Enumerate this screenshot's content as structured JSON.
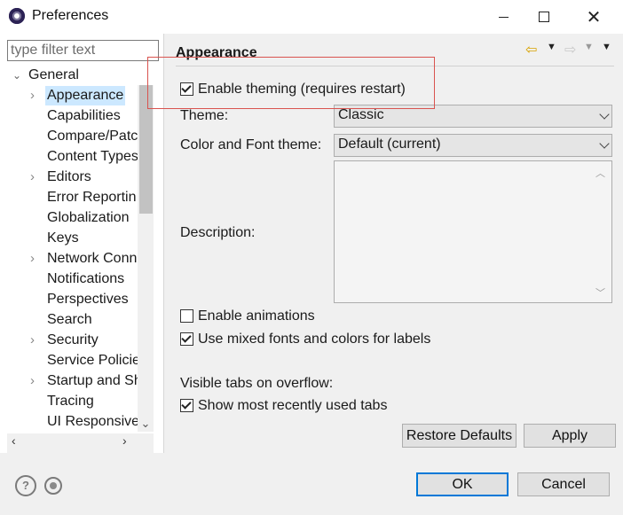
{
  "window": {
    "title": "Preferences"
  },
  "filter": {
    "placeholder": "type filter text"
  },
  "tree": {
    "root": "General",
    "items": [
      {
        "label": "Appearance",
        "expandable": true,
        "selected": true
      },
      {
        "label": "Capabilities",
        "expandable": false
      },
      {
        "label": "Compare/Patc",
        "expandable": false
      },
      {
        "label": "Content Types",
        "expandable": false
      },
      {
        "label": "Editors",
        "expandable": true
      },
      {
        "label": "Error Reportin",
        "expandable": false
      },
      {
        "label": "Globalization",
        "expandable": false
      },
      {
        "label": "Keys",
        "expandable": false
      },
      {
        "label": "Network Conn",
        "expandable": true
      },
      {
        "label": "Notifications",
        "expandable": false
      },
      {
        "label": "Perspectives",
        "expandable": false
      },
      {
        "label": "Search",
        "expandable": false
      },
      {
        "label": "Security",
        "expandable": true
      },
      {
        "label": "Service Policie",
        "expandable": false
      },
      {
        "label": "Startup and Sh",
        "expandable": true
      },
      {
        "label": "Tracing",
        "expandable": false
      },
      {
        "label": "UI Responsive",
        "expandable": false
      }
    ]
  },
  "page": {
    "title": "Appearance",
    "enable_theming": {
      "label": "Enable theming (requires restart)",
      "checked": true
    },
    "theme": {
      "label": "Theme:",
      "value": "Classic"
    },
    "color_font_theme": {
      "label": "Color and Font theme:",
      "value": "Default (current)"
    },
    "description": {
      "label": "Description:"
    },
    "enable_animations": {
      "label": "Enable animations",
      "checked": false
    },
    "mixed_fonts": {
      "label": "Use mixed fonts and colors for labels",
      "checked": true
    },
    "visible_tabs": {
      "label": "Visible tabs on overflow:"
    },
    "show_recent_tabs": {
      "label": "Show most recently used tabs",
      "checked": true
    },
    "restore_defaults": "Restore Defaults",
    "apply": "Apply"
  },
  "footer": {
    "ok": "OK",
    "cancel": "Cancel"
  },
  "colors": {
    "highlight_border": "#d9534f",
    "selection": "#cce8ff",
    "back_arrow": "#d9a200",
    "default_button_border": "#0078d7"
  }
}
